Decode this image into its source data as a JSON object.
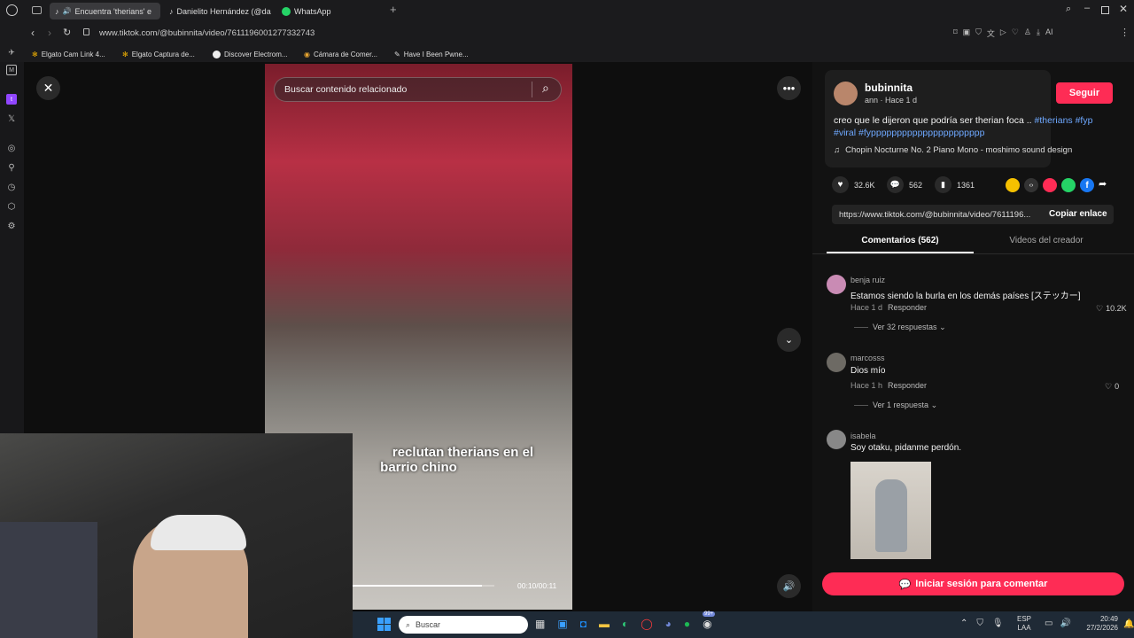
{
  "browser": {
    "tabs": [
      {
        "label": "Encuentra 'therians' e",
        "active": true
      },
      {
        "label": "Danielito Hernández (@da",
        "active": false
      },
      {
        "label": "WhatsApp",
        "active": false
      }
    ],
    "url": "www.tiktok.com/@bubinnita/video/7611196001277332743",
    "bookmarks": [
      "Elgato Cam Link 4...",
      "Elgato Captura de...",
      "Discover Electrom...",
      "Cámara de Comer...",
      "Have I Been Pwne..."
    ],
    "ai_label": "AI"
  },
  "video": {
    "search_placeholder": "Buscar contenido relacionado",
    "caption_line1": "reclutan therians en el",
    "caption_line2": "barrio chino",
    "time": "00:10/00:11",
    "progress": 0.91
  },
  "post": {
    "username": "bubinnita",
    "subline": "ann · Hace 1 d",
    "follow_label": "Seguir",
    "description_text": "creo que le dijeron que podría ser therian foca .. ",
    "hashtags_line1": "#therians #fyp",
    "hashtags_line2": "#viral #fypppppppppppppppppppppp",
    "music": "Chopin Nocturne No. 2 Piano Mono - moshimo sound design",
    "likes": "32.6K",
    "comments": "562",
    "saves": "1361",
    "link": "https://www.tiktok.com/@bubinnita/video/7611196...",
    "copy_label": "Copiar enlace"
  },
  "tabs": {
    "comments_label": "Comentarios (562)",
    "creator_label": "Videos del creador"
  },
  "comments": [
    {
      "name": "benja ruiz",
      "text": "Estamos siendo la burla en los demás países [ステッカー]",
      "time": "Hace 1 d",
      "reply": "Responder",
      "likes": "10.2K",
      "replies": "Ver 32 respuestas"
    },
    {
      "name": "marcosss",
      "text": "Dios mío",
      "time": "Hace 1 h",
      "reply": "Responder",
      "likes": "0",
      "replies": "Ver 1 respuesta"
    },
    {
      "name": "isabela",
      "text": "Soy otaku, pidanme perdón."
    }
  ],
  "login_label": "Iniciar sesión para comentar",
  "taskbar": {
    "search_placeholder": "Buscar",
    "lang1": "ESP",
    "lang2": "LAA",
    "time": "20:49",
    "date": "27/2/2026",
    "badge": "99+"
  },
  "colors": {
    "accent": "#fe2c55",
    "hashtag": "#6ea8ff"
  }
}
